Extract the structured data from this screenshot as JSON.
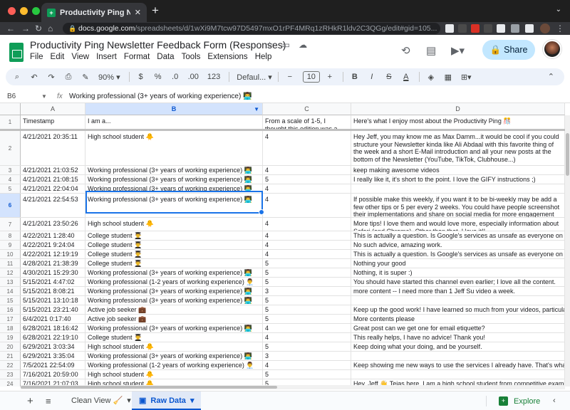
{
  "browser": {
    "tab_title": "Productivity Ping Newsletter Fe",
    "url_domain": "docs.google.com",
    "url_path": "/spreadsheets/d/1wXi9M7tcw97D5497mxO1rPF4MRq1zRHkR1ldv2C3QGg/edit#gid=105...",
    "colors": {
      "close": "#ff5f57",
      "minimize": "#febc2e",
      "maximize": "#28c840",
      "sheets_green": "#0f9d58"
    }
  },
  "doc": {
    "title": "Productivity Ping Newsletter Feedback Form (Responses)",
    "menus": [
      "File",
      "Edit",
      "View",
      "Insert",
      "Format",
      "Data",
      "Tools",
      "Extensions",
      "Help"
    ],
    "share_label": "Share"
  },
  "toolbar": {
    "zoom": "90%",
    "currency": "$",
    "percent": "%",
    "dec_decrease": ".0",
    "dec_increase": ".00",
    "num_format": "123",
    "font": "Defaul...",
    "font_size": "10",
    "bold": "B",
    "italic": "I",
    "strike": "S",
    "text_color": "A"
  },
  "formula_bar": {
    "cell_ref": "B6",
    "fx": "fx",
    "value": "Working professional (3+ years of working experience) 👨‍💻"
  },
  "columns": [
    {
      "letter": "A",
      "selected": false
    },
    {
      "letter": "B",
      "selected": true
    },
    {
      "letter": "C",
      "selected": false
    },
    {
      "letter": "D",
      "selected": false
    }
  ],
  "rows": [
    {
      "num": "1",
      "a": "Timestamp",
      "b": "I am a...",
      "c": "From a scale of 1-5, I thought this edition was a...",
      "d": "Here's what I enjoy most about the Productivity Ping 🎊"
    },
    {
      "num": "2",
      "a": "4/21/2021 20:35:11",
      "b": "High school student 🐥",
      "c": "4",
      "d": "Hey Jeff, you may know me as Max Damm...it would be cool if you could structure your Newsletter kinda like Ali Abdaal with this favorite thing of the week and a short E-Mail introduction and all your new posts at the bottom of the Newsletter (YouTube, TikTok, Clubhouse...)"
    },
    {
      "num": "3",
      "a": "4/21/2021 21:03:52",
      "b": "Working professional (3+ years of working experience) 👨‍💻",
      "c": "4",
      "d": "keep making awesome videos"
    },
    {
      "num": "4",
      "a": "4/21/2021 21:08:15",
      "b": "Working professional (3+ years of working experience) 👨‍💻",
      "c": "5",
      "d": "I really like it, it's short to the point. I love the GIFY instructions ;)"
    },
    {
      "num": "5",
      "a": "4/21/2021 22:04:04",
      "b": "Working professional (3+ years of working experience) 👨‍💻",
      "c": "4",
      "d": ""
    },
    {
      "num": "6",
      "a": "4/21/2021 22:54:53",
      "b": "Working professional (3+ years of working experience) 👨‍💻",
      "c": "4",
      "d": "If possible make this weekly, if you want it to be bi-weekly may be add a few other tips or 5 per every 2 weeks. You could have people screenshot their implementations and share on social media for more engagement but what do I know, I'm just a fan!"
    },
    {
      "num": "7",
      "a": "4/21/2021 23:50:26",
      "b": "High school student 🐥",
      "c": "4",
      "d": "More tips! I love them and would love more, especially information about Safari (and Chrome). Other than that, I love it!!"
    },
    {
      "num": "8",
      "a": "4/22/2021 1:28:40",
      "b": "College student 👨‍🎓",
      "c": "4",
      "d": "This is actually a question. Is Google's services as unsafe as everyone on the internet"
    },
    {
      "num": "9",
      "a": "4/22/2021 9:24:04",
      "b": "College student 👨‍🎓",
      "c": "4",
      "d": "No such advice, amazing work."
    },
    {
      "num": "10",
      "a": "4/22/2021 12:19:19",
      "b": "College student 👨‍🎓",
      "c": "4",
      "d": "This is actually a question. Is Google's services as unsafe as everyone on the internet"
    },
    {
      "num": "11",
      "a": "4/28/2021 21:38:39",
      "b": "College student 👨‍🎓",
      "c": "5",
      "d": "Nothing your good"
    },
    {
      "num": "12",
      "a": "4/30/2021 15:29:30",
      "b": "Working professional (3+ years of working experience) 👨‍💻",
      "c": "5",
      "d": "Nothing, it is super :)"
    },
    {
      "num": "13",
      "a": "5/15/2021 4:47:02",
      "b": "Working professional (1-2 years of working experience) 👨‍💼",
      "c": "5",
      "d": "You should have started this channel even earlier; I love all the content."
    },
    {
      "num": "14",
      "a": "5/15/2021 8:08:21",
      "b": "Working professional (3+ years of working experience) 👨‍💻",
      "c": "3",
      "d": "more content -- I need more than 1 Jeff Su video a week."
    },
    {
      "num": "15",
      "a": "5/15/2021 13:10:18",
      "b": "Working professional (3+ years of working experience) 👨‍💻",
      "c": "5",
      "d": ""
    },
    {
      "num": "16",
      "a": "5/15/2021 23:21:40",
      "b": "Active job seeker 💼",
      "c": "5",
      "d": "Keep up the good work! I have learned so much from your videos, particularly the"
    },
    {
      "num": "17",
      "a": "6/4/2021 0:17:40",
      "b": "Active job seeker 💼",
      "c": "5",
      "d": "More contents please"
    },
    {
      "num": "18",
      "a": "6/28/2021 18:16:42",
      "b": "Working professional (3+ years of working experience) 👨‍💻",
      "c": "4",
      "d": "Great post can we get one for email etiquette?"
    },
    {
      "num": "19",
      "a": "6/28/2021 22:19:10",
      "b": "College student 👨‍🎓",
      "c": "4",
      "d": "This really helps, I have no advice! Thank you!"
    },
    {
      "num": "20",
      "a": "6/29/2021 3:03:34",
      "b": "High school student 🐥",
      "c": "5",
      "d": "Keep doing what your doing, and be yourself."
    },
    {
      "num": "21",
      "a": "6/29/2021 3:35:04",
      "b": "Working professional (3+ years of working experience) 👨‍💻",
      "c": "3",
      "d": ""
    },
    {
      "num": "22",
      "a": "7/5/2021 22:54:09",
      "b": "Working professional (1-2 years of working experience) 👨‍💼",
      "c": "4",
      "d": "Keep showing me new ways to use the services I already have. That's what made"
    },
    {
      "num": "23",
      "a": "7/16/2021 20:59:00",
      "b": "High school student 🐥",
      "c": "5",
      "d": ""
    },
    {
      "num": "24",
      "a": "7/16/2021 21:07:03",
      "b": "High school student 🐥",
      "c": "5",
      "d": "Hey, Jeff 👋 Tejas here. I am a high school student from competitive exams"
    }
  ],
  "bottom": {
    "sheets": [
      {
        "name": "Clean View 🧹",
        "active": false
      },
      {
        "name": "Raw Data",
        "active": true
      }
    ],
    "explore": "Explore"
  }
}
